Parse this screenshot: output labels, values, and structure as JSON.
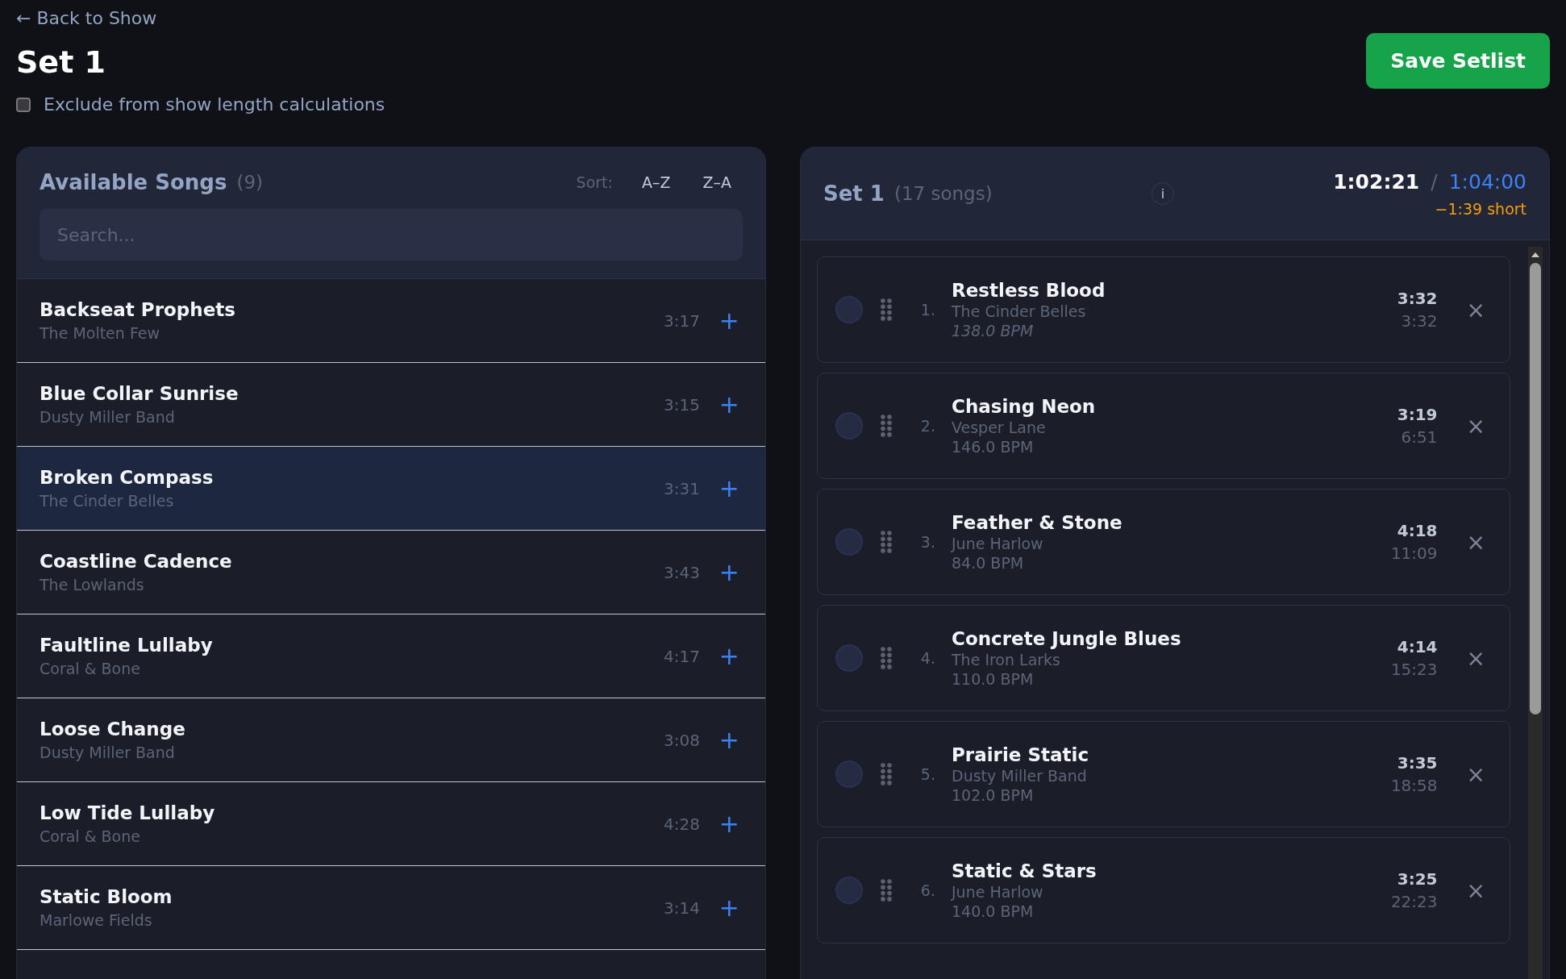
{
  "back_link": "← Back to Show",
  "title": "Set 1",
  "save_button": "Save Setlist",
  "exclude_option": {
    "label": "Exclude from show length calculations",
    "checked": false
  },
  "available": {
    "title": "Available Songs",
    "count": "(9)",
    "sort_label": "Sort:",
    "sort_options": [
      {
        "label": "A–Z",
        "selected": false
      },
      {
        "label": "Z–A",
        "selected": false
      }
    ],
    "search": {
      "placeholder": "Search..."
    },
    "songs": [
      {
        "title": "Backseat Prophets",
        "artist": "The Molten Few",
        "duration": "3:17",
        "add": "+",
        "selected": false
      },
      {
        "title": "Blue Collar Sunrise",
        "artist": "Dusty Miller Band",
        "duration": "3:15",
        "add": "+",
        "selected": false
      },
      {
        "title": "Broken Compass",
        "artist": "The Cinder Belles",
        "duration": "3:31",
        "add": "+",
        "selected": true
      },
      {
        "title": "Coastline Cadence",
        "artist": "The Lowlands",
        "duration": "3:43",
        "add": "+",
        "selected": false
      },
      {
        "title": "Faultline Lullaby",
        "artist": "Coral & Bone",
        "duration": "4:17",
        "add": "+",
        "selected": false
      },
      {
        "title": "Loose Change",
        "artist": "Dusty Miller Band",
        "duration": "3:08",
        "add": "+",
        "selected": false
      },
      {
        "title": "Low Tide Lullaby",
        "artist": "Coral & Bone",
        "duration": "4:28",
        "add": "+",
        "selected": false
      },
      {
        "title": "Static Bloom",
        "artist": "Marlowe Fields",
        "duration": "3:14",
        "add": "+",
        "selected": false
      }
    ]
  },
  "setlist": {
    "title": "Set 1",
    "count": "(17 songs)",
    "info": "i",
    "total": "1:02:21",
    "separator": "/",
    "target": "1:04:00",
    "difference": "−1:39 short",
    "songs": [
      {
        "number": "1.",
        "title": "Restless Blood",
        "artist": "The Cinder Belles",
        "bpm": "138.0 BPM",
        "bpm_estimated": true,
        "duration": "3:32",
        "running": "3:32",
        "remove": "×"
      },
      {
        "number": "2.",
        "title": "Chasing Neon",
        "artist": "Vesper Lane",
        "bpm": "146.0 BPM",
        "bpm_estimated": false,
        "duration": "3:19",
        "running": "6:51",
        "remove": "×"
      },
      {
        "number": "3.",
        "title": "Feather & Stone",
        "artist": "June Harlow",
        "bpm": "84.0 BPM",
        "bpm_estimated": false,
        "duration": "4:18",
        "running": "11:09",
        "remove": "×"
      },
      {
        "number": "4.",
        "title": "Concrete Jungle Blues",
        "artist": "The Iron Larks",
        "bpm": "110.0 BPM",
        "bpm_estimated": false,
        "duration": "4:14",
        "running": "15:23",
        "remove": "×"
      },
      {
        "number": "5.",
        "title": "Prairie Static",
        "artist": "Dusty Miller Band",
        "bpm": "102.0 BPM",
        "bpm_estimated": false,
        "duration": "3:35",
        "running": "18:58",
        "remove": "×"
      },
      {
        "number": "6.",
        "title": "Static & Stars",
        "artist": "June Harlow",
        "bpm": "140.0 BPM",
        "bpm_estimated": false,
        "duration": "3:25",
        "running": "22:23",
        "remove": "×"
      }
    ]
  }
}
